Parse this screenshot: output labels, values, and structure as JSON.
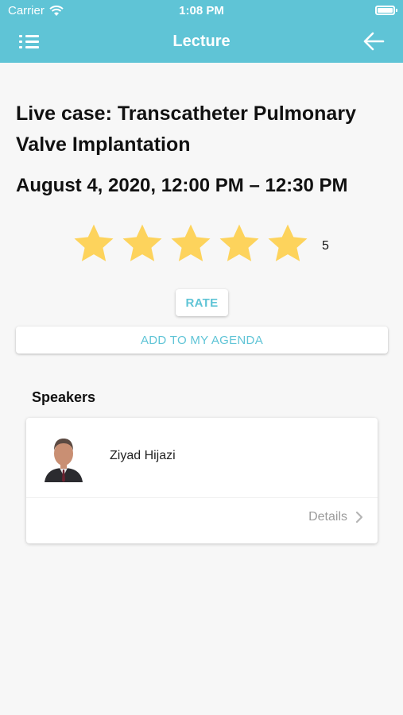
{
  "status_bar": {
    "carrier": "Carrier",
    "time": "1:08 PM"
  },
  "nav": {
    "title": "Lecture",
    "menu_icon": "list-icon",
    "back_icon": "arrow-left-icon"
  },
  "lecture": {
    "title": "Live case: Transcatheter Pulmonary Valve Implantation",
    "datetime": "August 4, 2020, 12:00 PM – 12:30 PM",
    "rating": {
      "value": "5",
      "stars_filled": 5,
      "stars_total": 5
    }
  },
  "actions": {
    "rate_label": "RATE",
    "agenda_label": "ADD TO MY AGENDA"
  },
  "speakers": {
    "heading": "Speakers",
    "items": [
      {
        "name": "Ziyad Hijazi",
        "details_label": "Details"
      }
    ]
  },
  "colors": {
    "accent": "#5fc4d6",
    "star": "#fdd35c",
    "background": "#f7f7f7"
  }
}
